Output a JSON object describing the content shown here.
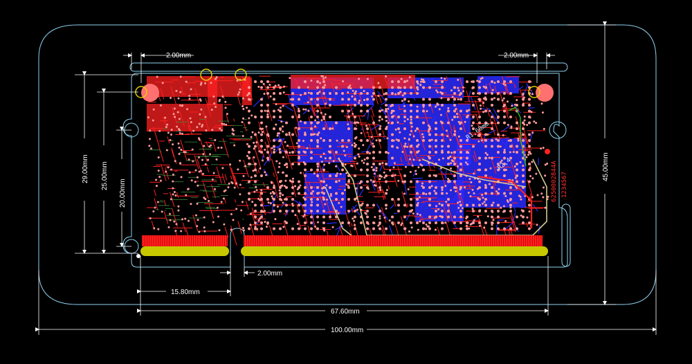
{
  "dimensions": {
    "top_left_gap": "2.00mm",
    "top_right_gap": "2.00mm",
    "height_outer": "29.00mm",
    "height_mid": "25.00mm",
    "height_inner": "20.00mm",
    "height_total": "45.00mm",
    "edge_segment": "15.80mm",
    "notch_gap": "2.00mm",
    "connector_span": "67.60mm",
    "total_width": "100.00mm"
  },
  "silkscreen": {
    "designator_1": "R1,60mm",
    "designator_2": "R2,4",
    "part_number": "6250002844A",
    "serial": "1234567"
  },
  "colors": {
    "board_outline": "#8fd3f2",
    "top_copper": "#ff2020",
    "bottom_copper": "#2a2aff",
    "pad": "#ff9a9a",
    "gold_finger": "#c8c800",
    "silk_yellow": "#d8d800",
    "dimension": "#ffffff"
  },
  "icons": {
    "mounting_hole": "mounting-hole-icon",
    "fiducial": "fiducial-icon",
    "origin": "origin-icon"
  }
}
